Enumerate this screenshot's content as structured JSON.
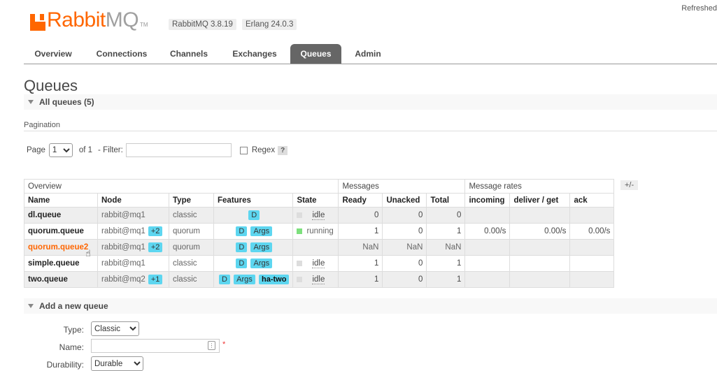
{
  "header": {
    "logo_rabbit": "Rabbit",
    "logo_mq": "MQ",
    "logo_tm": "TM",
    "rabbit_version": "RabbitMQ 3.8.19",
    "erlang_version": "Erlang 24.0.3",
    "refreshed": "Refreshed"
  },
  "nav": {
    "tabs": [
      "Overview",
      "Connections",
      "Channels",
      "Exchanges",
      "Queues",
      "Admin"
    ],
    "active": "Queues"
  },
  "page": {
    "title": "Queues",
    "all_queues": "All queues (5)",
    "pagination_label": "Pagination"
  },
  "filter": {
    "page_label": "Page",
    "page_value": "1",
    "of_label": "of 1",
    "filter_label": "- Filter:",
    "filter_value": "",
    "regex_label": "Regex",
    "help": "?"
  },
  "table": {
    "group_headers": [
      "Overview",
      "Messages",
      "Message rates"
    ],
    "plus_minus": "+/-",
    "columns": [
      "Name",
      "Node",
      "Type",
      "Features",
      "State",
      "Ready",
      "Unacked",
      "Total",
      "incoming",
      "deliver / get",
      "ack"
    ],
    "rows": [
      {
        "name": "dl.queue",
        "node": "rabbit@mq1",
        "node_extra": "",
        "type": "classic",
        "features": [
          "D"
        ],
        "ha": "",
        "state": "idle",
        "ready": "0",
        "unacked": "0",
        "total": "0",
        "incoming": "",
        "deliver": "",
        "ack": ""
      },
      {
        "name": "quorum.queue",
        "node": "rabbit@mq1",
        "node_extra": "+2",
        "type": "quorum",
        "features": [
          "D",
          "Args"
        ],
        "ha": "",
        "state": "running",
        "ready": "1",
        "unacked": "0",
        "total": "1",
        "incoming": "0.00/s",
        "deliver": "0.00/s",
        "ack": "0.00/s"
      },
      {
        "name": "quorum.queue2",
        "node": "rabbit@mq1",
        "node_extra": "+2",
        "type": "quorum",
        "features": [
          "D",
          "Args"
        ],
        "ha": "",
        "state": "",
        "ready": "NaN",
        "unacked": "NaN",
        "total": "NaN",
        "incoming": "",
        "deliver": "",
        "ack": ""
      },
      {
        "name": "simple.queue",
        "node": "rabbit@mq1",
        "node_extra": "",
        "type": "classic",
        "features": [
          "D",
          "Args"
        ],
        "ha": "",
        "state": "idle",
        "ready": "1",
        "unacked": "0",
        "total": "1",
        "incoming": "",
        "deliver": "",
        "ack": ""
      },
      {
        "name": "two.queue",
        "node": "rabbit@mq2",
        "node_extra": "+1",
        "type": "classic",
        "features": [
          "D",
          "Args"
        ],
        "ha": "ha-two",
        "state": "idle",
        "ready": "1",
        "unacked": "0",
        "total": "1",
        "incoming": "",
        "deliver": "",
        "ack": ""
      }
    ]
  },
  "add_queue": {
    "title": "Add a new queue",
    "type_label": "Type:",
    "type_value": "Classic",
    "name_label": "Name:",
    "name_value": "",
    "required_mark": "*",
    "durability_label": "Durability:",
    "durability_value": "Durable"
  },
  "colors": {
    "brand": "#ff6600",
    "active_tab": "#666666",
    "badge": "#5dd6f0",
    "running": "#7de07d"
  }
}
